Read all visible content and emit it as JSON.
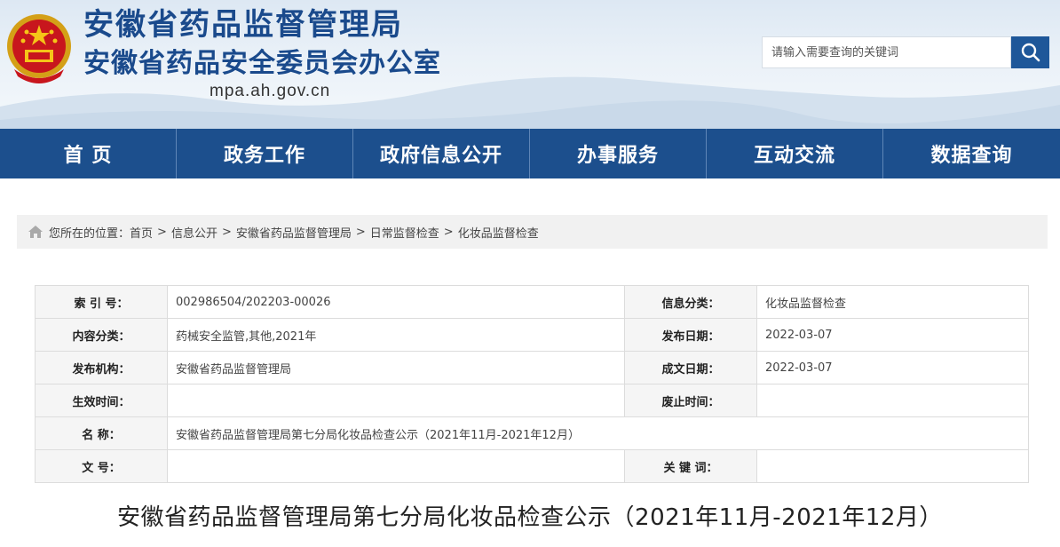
{
  "header": {
    "title_line1": "安徽省药品监督管理局",
    "title_line2": "安徽省药品安全委员会办公室",
    "domain": "mpa.ah.gov.cn",
    "brand_color": "#1a4a8c",
    "search": {
      "placeholder": "请输入需要查询的关键词",
      "button_icon": "search-icon"
    }
  },
  "nav": {
    "items": [
      "首  页",
      "政务工作",
      "政府信息公开",
      "办事服务",
      "互动交流",
      "数据查询"
    ],
    "bg_color": "#1c4f8d"
  },
  "breadcrumb": {
    "icon": "home-icon",
    "prefix": "您所在的位置：",
    "items": [
      "首页",
      "信息公开",
      "安徽省药品监督管理局",
      "日常监督检查",
      "化妆品监督检查"
    ],
    "separator": ">"
  },
  "info": {
    "index_label": "索  引  号：",
    "index_value": "002986504/202203-00026",
    "category_label": "信息分类：",
    "category_value": "化妆品监督检查",
    "content_type_label": "内容分类：",
    "content_type_value": "药械安全监管,其他,2021年",
    "publish_date_label": "发布日期：",
    "publish_date_value": "2022-03-07",
    "publisher_label": "发布机构：",
    "publisher_value": "安徽省药品监督管理局",
    "created_date_label": "成文日期：",
    "created_date_value": "2022-03-07",
    "effective_label": "生效时间：",
    "effective_value": "",
    "expiry_label": "废止时间：",
    "expiry_value": "",
    "name_label": "名      称：",
    "name_value": "安徽省药品监督管理局第七分局化妆品检查公示（2021年11月-2021年12月）",
    "doc_no_label": "文      号：",
    "doc_no_value": "",
    "keywords_label": "关  键  词：",
    "keywords_value": ""
  },
  "article": {
    "title": "安徽省药品监督管理局第七分局化妆品检查公示（2021年11月-2021年12月）"
  }
}
